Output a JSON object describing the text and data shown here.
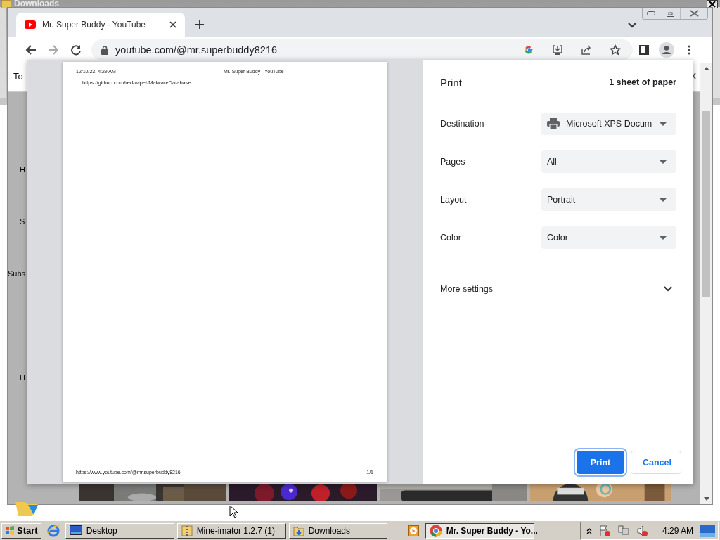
{
  "background_window": {
    "title": "Downloads"
  },
  "browser": {
    "tabs": [
      {
        "title": "Mr. Super Buddy - YouTube",
        "selected": true
      }
    ],
    "address": "youtube.com/@mr.superbuddy8216"
  },
  "page_behind": {
    "labels": [
      "To",
      "H",
      "S",
      "Subs",
      "H"
    ]
  },
  "print_preview": {
    "header_left": "12/10/23, 4:29 AM",
    "header_center": "Mr. Super Buddy - YouTube",
    "body": "https://github.com/red-wipet/MalwareDatabase",
    "footer_left": "https://www.youtube.com/@mr.superbuddy8216",
    "footer_right": "1/1"
  },
  "print_settings": {
    "title": "Print",
    "sheets": "1 sheet of paper",
    "settings": [
      {
        "label": "Destination",
        "value": "Microsoft XPS Docum",
        "kind": "printer"
      },
      {
        "label": "Pages",
        "value": "All",
        "kind": "plain"
      },
      {
        "label": "Layout",
        "value": "Portrait",
        "kind": "plain"
      },
      {
        "label": "Color",
        "value": "Color",
        "kind": "plain"
      }
    ],
    "more_settings": {
      "label": "More settings",
      "expanded": false
    },
    "buttons": [
      {
        "label": "Print",
        "kind": "primary"
      },
      {
        "label": "Cancel",
        "kind": "secondary"
      }
    ]
  },
  "taskbar": {
    "start": "Start",
    "items": [
      {
        "label": "Desktop",
        "kind": "desktop",
        "selected": false
      },
      {
        "label": "Mine-imator 1.2.7 (1)",
        "kind": "zip",
        "selected": false
      },
      {
        "label": "Downloads",
        "kind": "folder",
        "selected": false
      },
      {
        "label": "Mr. Super Buddy - Yo...",
        "kind": "chrome",
        "selected": true
      }
    ],
    "clock": "4:29 AM"
  }
}
